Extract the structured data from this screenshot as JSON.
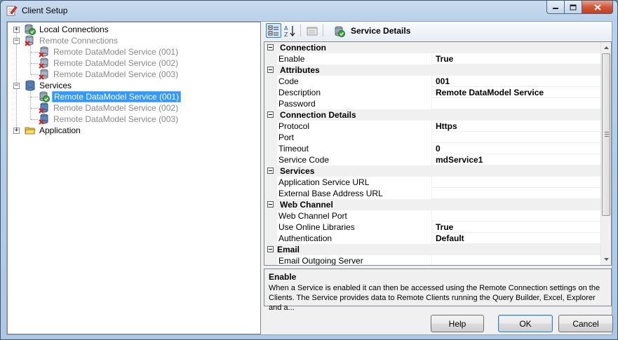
{
  "window": {
    "title": "Client Setup"
  },
  "tree": {
    "local_connections": "Local Connections",
    "remote_connections": {
      "label": "Remote Connections",
      "children": [
        "Remote DataModel Service (001)",
        "Remote DataModel Service (002)",
        "Remote DataModel Service (003)"
      ]
    },
    "services": {
      "label": "Services",
      "children": [
        "Remote DataModel Service (001)",
        "Remote DataModel Service (002)",
        "Remote DataModel Service (003)"
      ],
      "selected_index": 0
    },
    "application": "Application"
  },
  "toolbar": {
    "title": "Service Details"
  },
  "properties": {
    "connection": {
      "label": "Connection",
      "enable_label": "Enable",
      "enable_value": "True"
    },
    "attributes": {
      "label": "Attributes",
      "code_label": "Code",
      "code_value": "001",
      "description_label": "Description",
      "description_value": "Remote DataModel Service",
      "password_label": "Password",
      "password_value": ""
    },
    "connection_details": {
      "label": "Connection Details",
      "protocol_label": "Protocol",
      "protocol_value": "Https",
      "port_label": "Port",
      "port_value": "",
      "timeout_label": "Timeout",
      "timeout_value": "0",
      "service_code_label": "Service Code",
      "service_code_value": "mdService1"
    },
    "services": {
      "label": "Services",
      "app_url_label": "Application Service URL",
      "app_url_value": "",
      "ext_url_label": "External Base Address URL",
      "ext_url_value": ""
    },
    "web_channel": {
      "label": "Web Channel",
      "port_label": "Web Channel Port",
      "port_value": "",
      "online_libs_label": "Use Online Libraries",
      "online_libs_value": "True",
      "auth_label": "Authentication",
      "auth_value": "Default"
    },
    "email": {
      "label": "Email",
      "outgoing_label": "Email Outgoing Server",
      "outgoing_value": ""
    }
  },
  "help": {
    "title": "Enable",
    "description": "When a Service is enabled it can then be accessed using the Remote Connection settings on the Clients. The Service provides data to Remote Clients running the Query Builder, Excel, Explorer and a..."
  },
  "buttons": {
    "help": "Help",
    "ok": "OK",
    "cancel": "Cancel"
  },
  "colors": {
    "selection": "#3399ff",
    "title_close": "#c53c1e"
  },
  "icons": {
    "title": "edit-pencil-icon",
    "local": "database-check-icon",
    "remote": "database-error-icon",
    "services": "database-icon",
    "application": "folder-icon",
    "categorized": "categorized-icon",
    "alphabetical": "sort-az-icon",
    "property_pages": "property-pages-icon"
  }
}
